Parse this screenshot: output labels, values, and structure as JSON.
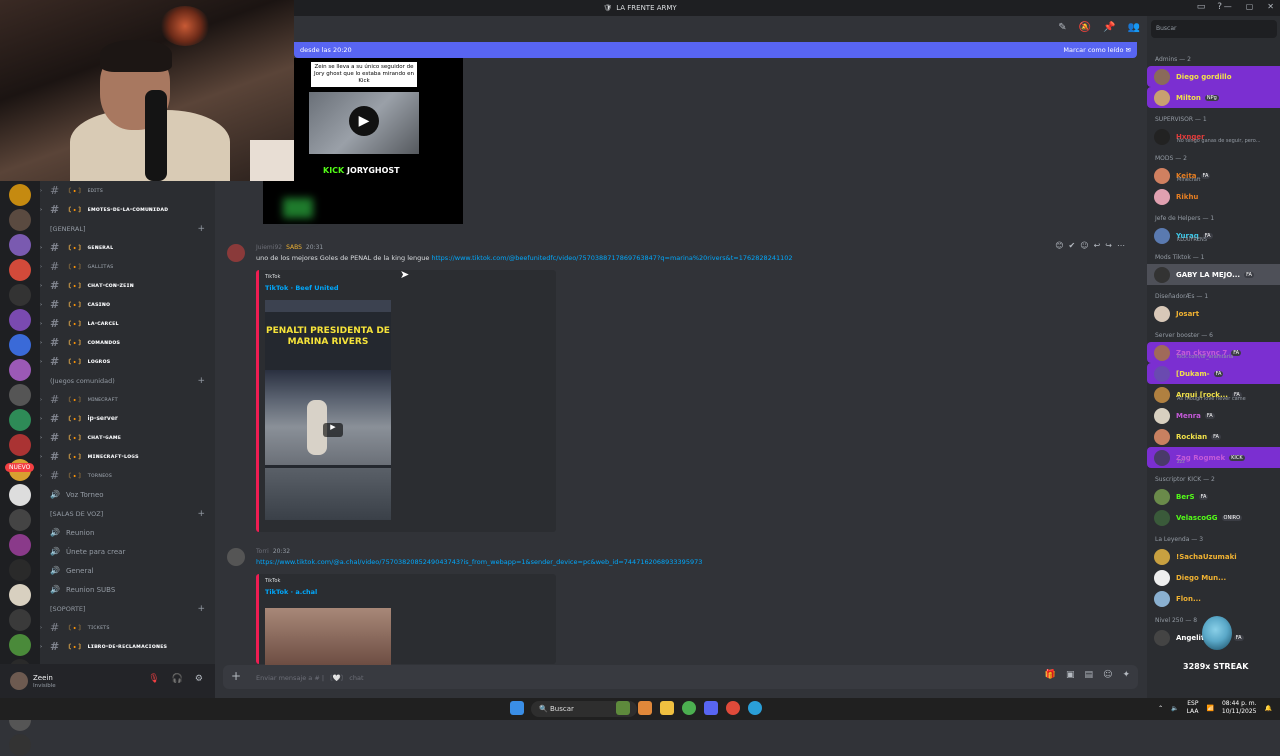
{
  "app": {
    "title": "LA FRENTE ARMY"
  },
  "new_messages_bar": {
    "left": "desde las 20:20",
    "right": "Marcar como leído"
  },
  "member_search": {
    "placeholder": "Buscar"
  },
  "channels": [
    {
      "type": "channel",
      "label": "ᴇᴅɪᴛꜱ",
      "bold": false
    },
    {
      "type": "channel",
      "label": "ᴇᴍᴏᴛᴇꜱ-ᴅᴇ-ʟᴀ-ᴄᴏᴍᴜɴɪᴅᴀᴅ",
      "bold": true
    },
    {
      "type": "category",
      "label": "[GENERAL]"
    },
    {
      "type": "channel",
      "label": "ɢᴇɴᴇʀᴀʟ",
      "bold": true
    },
    {
      "type": "channel",
      "label": "ɢᴀʟʟɪᴛᴀꜱ",
      "bold": false
    },
    {
      "type": "channel",
      "label": "ᴄʜᴀᴛ-ᴄᴏɴ-ᴢᴇɪɴ",
      "bold": true
    },
    {
      "type": "channel",
      "label": "ᴄᴀꜱɪɴᴏ",
      "bold": true
    },
    {
      "type": "channel",
      "label": "ʟᴀ-ᴄᴀʀᴄᴇʟ",
      "bold": true
    },
    {
      "type": "channel",
      "label": "ᴄᴏᴍᴀɴᴅᴏꜱ",
      "bold": true
    },
    {
      "type": "channel",
      "label": "ʟᴏɢʀᴏꜱ",
      "bold": true
    },
    {
      "type": "category",
      "label": "(Juegos comunidad)"
    },
    {
      "type": "channel",
      "label": "ᴍɪɴᴇᴄʀᴀꜰᴛ",
      "bold": false
    },
    {
      "type": "channel",
      "label": "ip-server",
      "bold": true
    },
    {
      "type": "channel",
      "label": "ᴄʜᴀᴛ-ɢᴀᴍᴇ",
      "bold": true
    },
    {
      "type": "channel",
      "label": "ᴍɪɴᴇᴄʀᴀꜰᴛ-ʟᴏɢꜱ",
      "bold": true
    },
    {
      "type": "channel",
      "label": "ᴛᴏʀɴᴇᴏꜱ",
      "bold": false
    },
    {
      "type": "voice",
      "label": "Voz Torneo"
    },
    {
      "type": "category",
      "label": "[SALAS DE VOZ]"
    },
    {
      "type": "voice",
      "label": "Reunion"
    },
    {
      "type": "voice",
      "label": "Únete para crear"
    },
    {
      "type": "voice",
      "label": "General"
    },
    {
      "type": "voice",
      "label": "Reunion SUBS"
    },
    {
      "type": "category",
      "label": "[SOPORTE]"
    },
    {
      "type": "channel",
      "label": "ᴛɪᴄᴋᴇᴛꜱ",
      "bold": false
    },
    {
      "type": "channel",
      "label": "ʟɪʙʀᴏ-ᴅᴇ-ʀᴇᴄʟᴀᴍᴀᴄɪᴏɴᴇꜱ",
      "bold": true
    }
  ],
  "server_badges": {
    "nuevo": "NUEVO"
  },
  "user": {
    "name": "Zeein",
    "status": "Invisible"
  },
  "messages": [
    {
      "author": "Juiemi92",
      "badge": "SABS",
      "time": "20:31",
      "text": "uno de los mejores Goles de PENAL de la king lengue",
      "link": "https://www.tiktok.com/@beefunitedfc/video/7570388717869763847?q=marina%20rivers&t=1762828241102",
      "embed": {
        "provider": "TikTok",
        "title": "TikTok · Beef United",
        "banner": "PENALTI PRESIDENTA DE MARINA RIVERS"
      }
    },
    {
      "author": "Torri",
      "time": "20:32",
      "link": "https://www.tiktok.com/@a.chal/video/7570382085249043743?is_from_webapp=1&sender_device=pc&web_id=7447162068933395973",
      "embed": {
        "provider": "TikTok",
        "title": "TikTok · a.chal"
      }
    }
  ],
  "video_embed": {
    "caption": "Zein se lleva a su único seguidor de Jory ghost que lo estaba mirando en Kick",
    "kick": "KICK",
    "channel": "JORYGHOST"
  },
  "input": {
    "placeholder": "Enviar mensaje a # | 〘🤍〙 chat"
  },
  "member_groups": [
    {
      "role": "Admins — 2",
      "members": [
        {
          "name": "Diego gordillo",
          "color": "#f0e14a",
          "hl": true
        },
        {
          "name": "Milton",
          "color": "#f0e14a",
          "tag": "NPg",
          "hl": true
        }
      ]
    },
    {
      "role": "SUPERVISOR — 1",
      "members": [
        {
          "name": "Hxnger",
          "color": "#e03b3b",
          "sub": "No tengo ganas de seguir, pero..."
        }
      ]
    },
    {
      "role": "MODS — 2",
      "members": [
        {
          "name": "Keita",
          "color": "#e67e22",
          "tag": "FA",
          "sub": "Minecraft"
        },
        {
          "name": "Rikhu",
          "color": "#e67e22"
        }
      ]
    },
    {
      "role": "Jefe de Helpers — 1",
      "members": [
        {
          "name": "Yuraq",
          "color": "#3ec8e8",
          "tag": "FA",
          "sub": "KLOUFRENS"
        }
      ]
    },
    {
      "role": "Mods Tiktok — 1",
      "members": [
        {
          "name": "GABY LA MEJO...",
          "color": "#ffffff",
          "tag": "FA",
          "dark": true
        }
      ]
    },
    {
      "role": "DiseñadorÆs — 1",
      "members": [
        {
          "name": "Josart",
          "color": "#f0b232"
        }
      ]
    },
    {
      "role": "Server booster — 6",
      "members": [
        {
          "name": "Zan cksync 7",
          "color": "#c45ad8",
          "tag": "FA",
          "sub": "kick.com/dr_aramtaria",
          "hl": true
        },
        {
          "name": "[Dukam-",
          "color": "#f0e14a",
          "tag": "FA",
          "hl": true
        },
        {
          "name": "Arqui [rock...",
          "color": "#f0e14a",
          "tag": "FA",
          "sub": "As though love never came"
        },
        {
          "name": "Menra",
          "color": "#c45ad8",
          "tag": "FA"
        },
        {
          "name": "Rockian",
          "color": "#f0e14a",
          "tag": "FA"
        },
        {
          "name": "Zag Rogmek",
          "color": "#c45ad8",
          "tag": "KICK",
          "sub": "zzz",
          "hl": true
        }
      ]
    },
    {
      "role": "Suscriptor KICK — 2",
      "members": [
        {
          "name": "BerS",
          "color": "#53fc18",
          "tag": "FA"
        },
        {
          "name": "VelascoGG",
          "color": "#53fc18",
          "tag": "ONIRO"
        }
      ]
    },
    {
      "role": "La Leyenda — 3",
      "members": [
        {
          "name": "!SachaUzumaki",
          "color": "#f0b232"
        },
        {
          "name": "Diego Mun...",
          "color": "#f0b232"
        },
        {
          "name": "Flon...",
          "color": "#f0b232"
        }
      ]
    },
    {
      "role": "Nivel 250 — 8",
      "members": [
        {
          "name": "AngelithoN11",
          "color": "#ffffff",
          "tag": "FA"
        }
      ]
    }
  ],
  "overlay": {
    "streak": "3289x STREAK"
  },
  "taskbar": {
    "search": "Buscar",
    "lang_top": "ESP",
    "lang_bottom": "LAA",
    "time": "08:44 p. m.",
    "date": "10/11/2025"
  },
  "colors": {
    "accent": "#5865f2",
    "link": "#00a8fc",
    "tiktok": "#ee1d52",
    "booster": "#7b2fd1"
  }
}
